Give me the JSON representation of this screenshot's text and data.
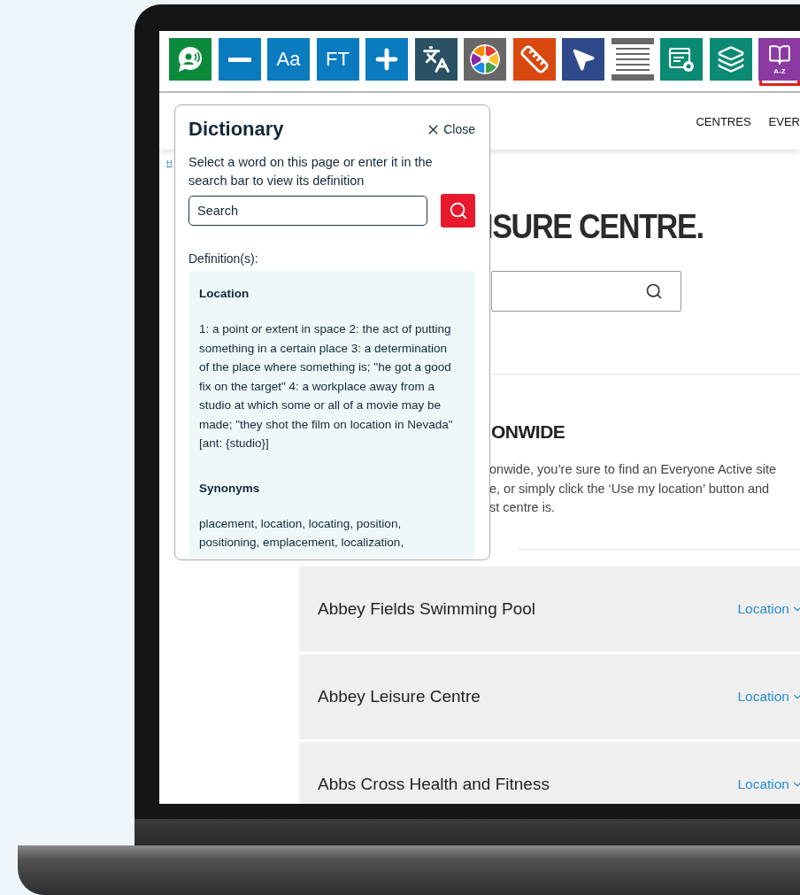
{
  "toolbar": {
    "tools": [
      {
        "kind": "speech",
        "color": "#0b8a3c",
        "selected": false
      },
      {
        "kind": "minus",
        "color": "#0a7bbf",
        "selected": false
      },
      {
        "kind": "text",
        "label": "Aa",
        "color": "#0a7bbf",
        "selected": false
      },
      {
        "kind": "text",
        "label": "FT",
        "color": "#0a7bbf",
        "selected": false
      },
      {
        "kind": "plus",
        "color": "#0a7bbf",
        "selected": false
      },
      {
        "kind": "translate",
        "color": "#2a5264",
        "selected": false
      },
      {
        "kind": "wheel",
        "color": "#676767",
        "selected": false
      },
      {
        "kind": "ruler",
        "color": "#d9480f",
        "selected": false
      },
      {
        "kind": "pointer",
        "color": "#2f4a8a",
        "selected": false
      },
      {
        "kind": "lines",
        "color": "#676767",
        "selected": false
      },
      {
        "kind": "reader",
        "color": "#0b8a73",
        "selected": false
      },
      {
        "kind": "layers",
        "color": "#0b8a73",
        "selected": false
      },
      {
        "kind": "book",
        "label": "A-Z",
        "color": "#8a3aa0",
        "selected": true
      }
    ]
  },
  "header": {
    "nav": [
      "CENTRES",
      "EVER"
    ]
  },
  "breadcrumb": "H",
  "page": {
    "heading": "ISURE CENTRE.",
    "section_heading": "ONWIDE",
    "intro": [
      "onwide, you’re sure to find an Everyone Active site",
      "e, or simply click the ‘Use my location’ button and",
      "st centre is."
    ]
  },
  "centres": [
    {
      "name": "Abbey Fields Swimming Pool",
      "link": "Location"
    },
    {
      "name": "Abbey Leisure Centre",
      "link": "Location"
    },
    {
      "name": "Abbs Cross Health and Fitness",
      "link": "Location"
    }
  ],
  "dictionary": {
    "title": "Dictionary",
    "close": "Close",
    "instructions": "Select a word on this page or enter it in the search bar to view its definition",
    "search": {
      "placeholder": "Search"
    },
    "definitions_label": "Definition(s):",
    "entries": [
      {
        "heading": "Location",
        "text": "1: a point or extent in space 2: the act of putting something in a certain place 3: a determination of the place where something is; \"he got a good fix on the target\" 4: a workplace away from a studio at which some or all of a movie may be made; \"they shot the film on location in Nevada\" [ant: {studio}]"
      },
      {
        "heading": "Synonyms",
        "text": "placement, location, locating, position, positioning, emplacement, localization,"
      }
    ]
  }
}
